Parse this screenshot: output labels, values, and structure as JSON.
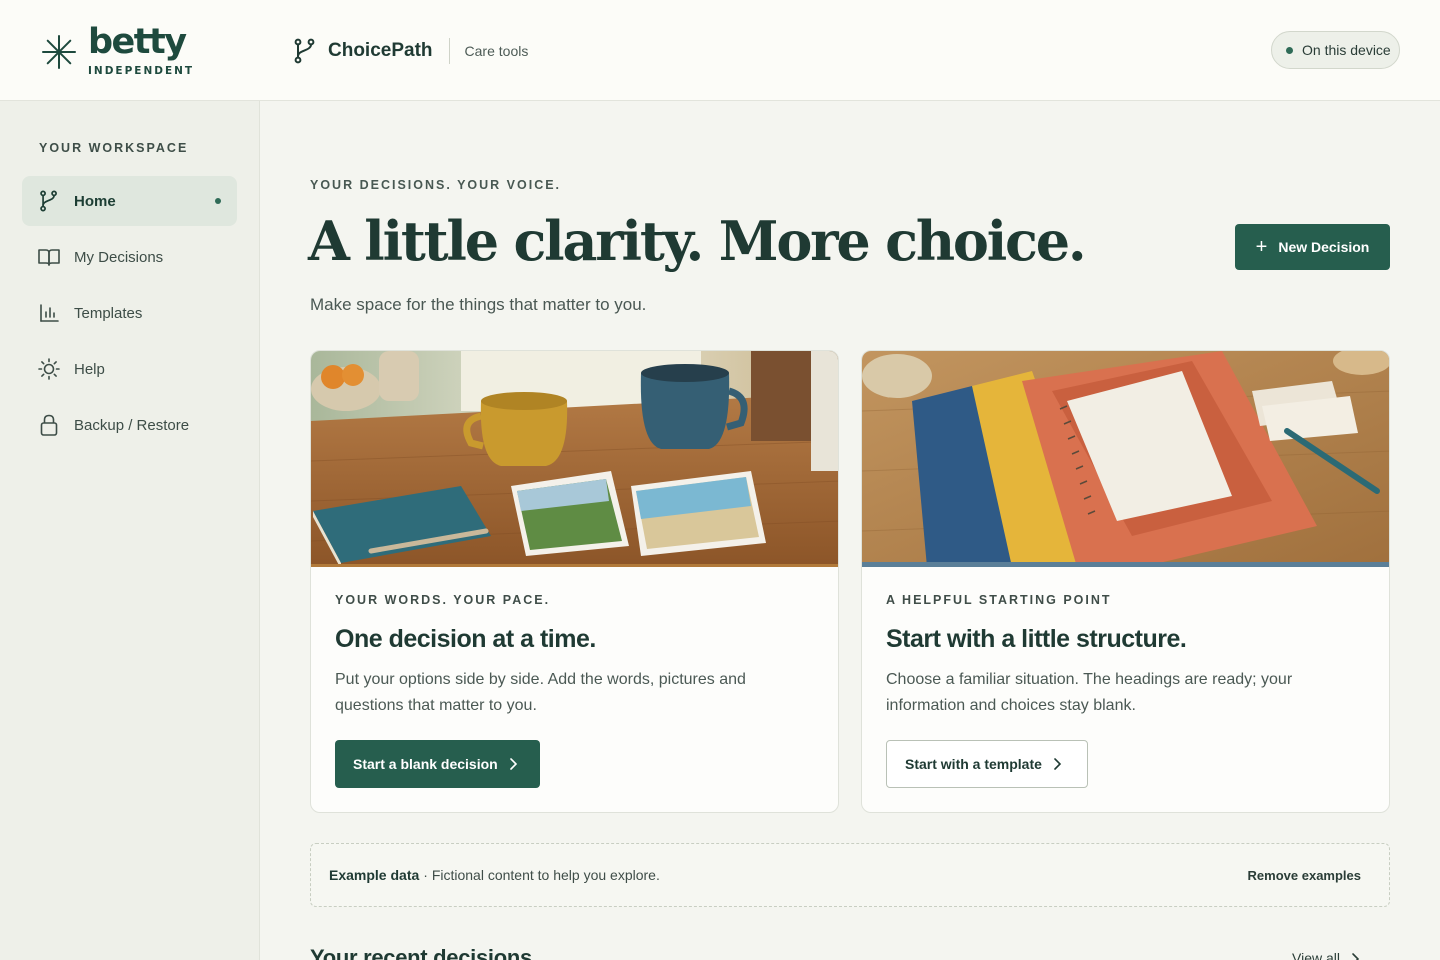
{
  "brand": {
    "name": "betty",
    "tagline": "INDEPENDENT"
  },
  "app": {
    "name": "ChoicePath",
    "section": "Care tools"
  },
  "status": {
    "label": "On this device"
  },
  "sidebar": {
    "heading": "YOUR WORKSPACE",
    "items": [
      {
        "label": "Home",
        "icon": "branch-icon",
        "active": true
      },
      {
        "label": "My Decisions",
        "icon": "book-icon"
      },
      {
        "label": "Templates",
        "icon": "chart-icon"
      },
      {
        "label": "Help",
        "icon": "sun-icon"
      },
      {
        "label": "Backup / Restore",
        "icon": "lock-icon"
      }
    ]
  },
  "hero": {
    "eyebrow": "YOUR DECISIONS. YOUR VOICE.",
    "title": "A little clarity. More choice.",
    "subtitle": "Make space for the things that matter to you.",
    "new_button": "New Decision"
  },
  "cards": [
    {
      "eyebrow": "YOUR WORDS. YOUR PACE.",
      "title": "One decision at a time.",
      "body": "Put your options side by side. Add the words, pictures and questions that matter to you.",
      "button": "Start a blank decision"
    },
    {
      "eyebrow": "A HELPFUL STARTING POINT",
      "title": "Start with a little structure.",
      "body": "Choose a familiar situation. The headings are ready; your information and choices stay blank.",
      "button": "Start with a template"
    }
  ],
  "notice": {
    "label": "Example data",
    "text": "· Fictional content to help you explore.",
    "action": "Remove examples"
  },
  "recent": {
    "title": "Your recent decisions",
    "view_all": "View all"
  },
  "colors": {
    "accent": "#265e4e",
    "background": "#f4f5f0",
    "text": "#1f3a33"
  }
}
